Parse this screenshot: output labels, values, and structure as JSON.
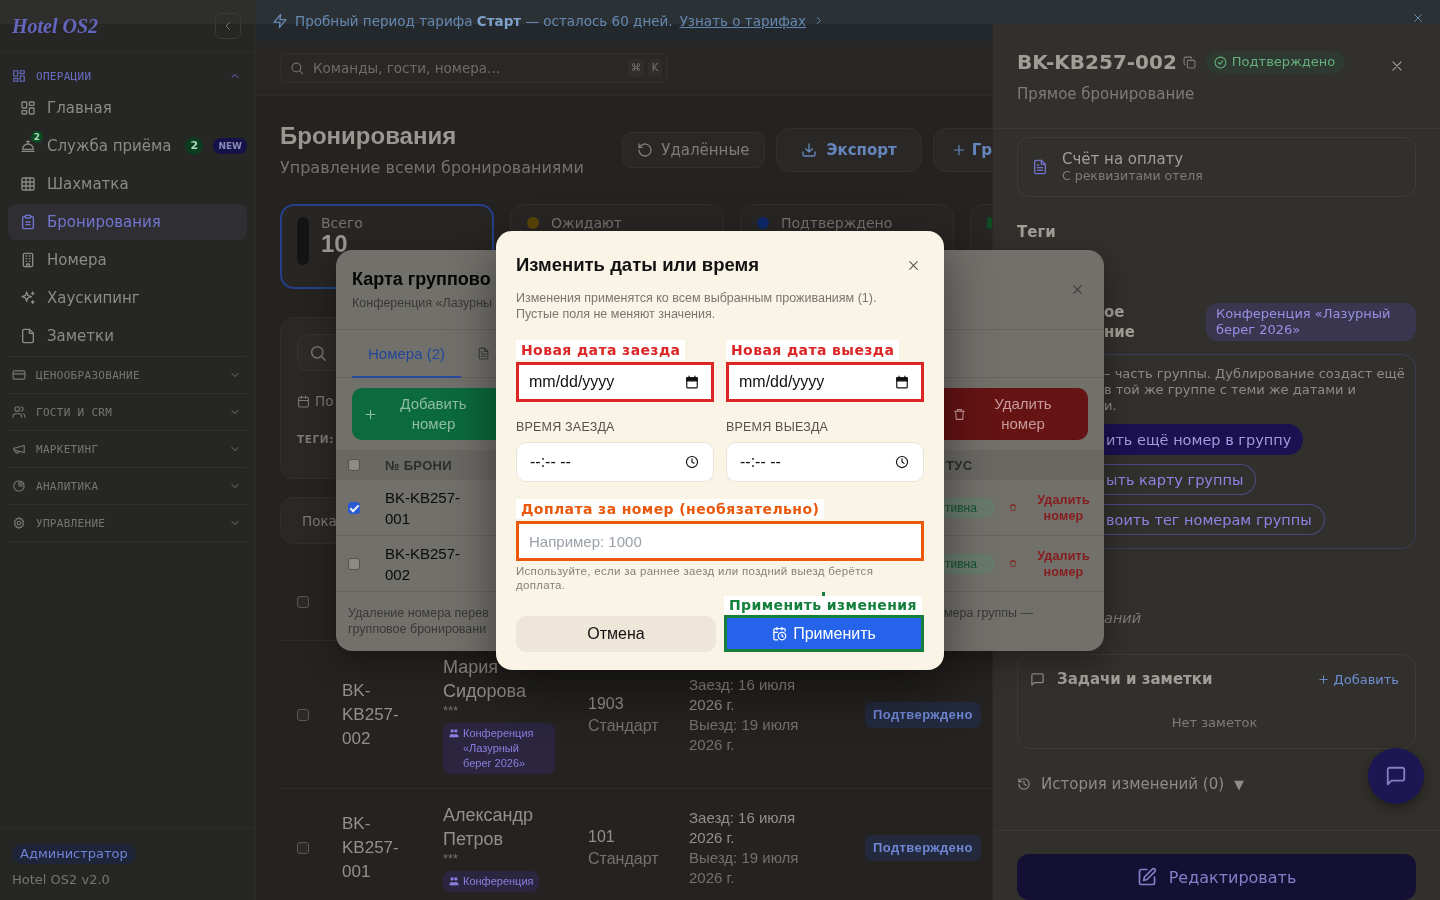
{
  "sidebar": {
    "logo": "Hotel OS2",
    "sections": [
      {
        "title": "ОПЕРАЦИИ",
        "expanded": true,
        "items": [
          {
            "label": "Главная",
            "selected": false
          },
          {
            "label": "Служба приёма",
            "selected": false,
            "icon_badge": "2",
            "count": "2",
            "badge": "NEW"
          },
          {
            "label": "Шахматка",
            "selected": false
          },
          {
            "label": "Бронирования",
            "selected": true
          },
          {
            "label": "Номера",
            "selected": false
          },
          {
            "label": "Хаускипинг",
            "selected": false
          },
          {
            "label": "Заметки",
            "selected": false
          }
        ]
      },
      {
        "title": "ЦЕНООБРАЗОВАНИЕ",
        "expanded": false
      },
      {
        "title": "ГОСТИ И CRM",
        "expanded": false
      },
      {
        "title": "МАРКЕТИНГ",
        "expanded": false
      },
      {
        "title": "АНАЛИТИКА",
        "expanded": false
      },
      {
        "title": "УПРАВЛЕНИЕ",
        "expanded": false
      }
    ],
    "role": "Администратор",
    "version": "Hotel OS2 v2.0"
  },
  "banner": {
    "text": "Пробный период тарифа **Старт** — осталось 60 дней.",
    "link": "Узнать о тарифах"
  },
  "search": {
    "placeholder": "Команды, гости, номера...",
    "keys": [
      "⌘",
      "K"
    ]
  },
  "page": {
    "title": "Бронирования",
    "subtitle": "Управление всеми бронированиями",
    "actions": [
      {
        "kind": "restore",
        "label": "Удалённые"
      },
      {
        "kind": "export",
        "label": "Экспорт"
      },
      {
        "kind": "create",
        "label": "Гр"
      }
    ]
  },
  "stats": [
    {
      "label": "Всего",
      "value": "10",
      "color": "#141414",
      "selected": true
    },
    {
      "label": "Ожидают",
      "color": "#5a4408",
      "selected": false
    },
    {
      "label": "Подтверждено",
      "color": "#0e2a6a",
      "selected": false
    },
    {
      "color": "#0f4a22",
      "selected": false
    }
  ],
  "filters": {
    "date_label": "По",
    "tags_label": "ТЕГИ:"
  },
  "view_label": "Пока",
  "bookings": {
    "all_selected": false,
    "rows": [
      {
        "selected": false,
        "id": "BK-KB257-002",
        "guest": "Мария Сидорова",
        "rating": "***",
        "tag": "Конференция «Лазурный берег 2026»",
        "room": "1903",
        "room_type": "Стандарт",
        "checkin": "Заезд: 16 июля 2026 г.",
        "checkout": "Выезд: 19 июля 2026 г.",
        "status": "Подтверждено"
      },
      {
        "selected": false,
        "id": "BK-KB257-001",
        "guest": "Александр Петров",
        "rating": "***",
        "tag": "Конференция",
        "room": "101",
        "room_type": "Стандарт",
        "checkin": "Заезд: 16 июля 2026 г.",
        "checkout": "Выезд: 19 июля 2026 г.",
        "status": "Подтверждено"
      }
    ]
  },
  "drawer": {
    "id": "BK-KB257-002",
    "status": "Подтверждено",
    "source": "Прямое бронирование",
    "invoice": {
      "title": "Счёт на оплату",
      "subtitle": "С реквизитами отеля"
    },
    "tags_title": "Теги",
    "group_label": [
      "ое",
      "ние"
    ],
    "group_tag": "Конференция «Лазурный берег 2026»",
    "group_text": [
      "– часть группы. Дублирование создаст ещё",
      "в той же группе с теми же датами и",
      "и."
    ],
    "group_actions": [
      {
        "kind": "primary",
        "label": "ить ещё номер в группу"
      },
      {
        "kind": "outline",
        "label": "ыть карту группы"
      },
      {
        "kind": "outline",
        "label": "воить тег номерам группы"
      }
    ],
    "empty_note": "аний",
    "notes": {
      "title": "Задачи и заметки",
      "add": "Добавить",
      "empty": "Нет заметок"
    },
    "history": {
      "label": "История изменений (0)",
      "toggle": "▼"
    },
    "edit": "Редактировать"
  },
  "group_card": {
    "title": "Карта группово",
    "subtitle": "Конференция «Лазурны",
    "tabs": [
      {
        "label": "Номера (2)",
        "selected": true
      },
      {
        "selected": false
      }
    ],
    "actions": [
      {
        "kind": "add",
        "label": "Добавить номер"
      },
      {
        "kind": "remove",
        "label": "Удалить номер"
      }
    ],
    "columns": [
      "№ БРОНИ",
      "ТУС"
    ],
    "all_selected": false,
    "rows": [
      {
        "selected": true,
        "id": "BK-KB257-001",
        "status": "тивна",
        "action": "Удалить номер"
      },
      {
        "selected": false,
        "id": "BK-KB257-002",
        "status": "тивна",
        "action": "Удалить номер"
      }
    ],
    "footer_left": [
      "Удаление номера перев",
      "групповое бронировани"
    ],
    "footer_right": "мера группы —"
  },
  "dialog": {
    "title": "Изменить даты или время",
    "description": "Изменения применятся ко всем выбранным проживаниям (1). Пустые поля не меняют значения.",
    "fields": [
      {
        "kind": "date",
        "label": "Новая дата заезда",
        "color": "#dc2626",
        "placeholder": "mm/dd/yyyy"
      },
      {
        "kind": "date",
        "label": "Новая дата выезда",
        "color": "#dc2626",
        "placeholder": "mm/dd/yyyy"
      },
      {
        "kind": "time",
        "label": "ВРЕМЯ ЗАЕЗДА",
        "placeholder": "--:-- --"
      },
      {
        "kind": "time",
        "label": "ВРЕМЯ ВЫЕЗДА",
        "placeholder": "--:-- --"
      },
      {
        "kind": "number",
        "label": "Доплата за номер (необязательно)",
        "color": "#ea580c",
        "placeholder": "Например: 1000",
        "hint": "Используйте, если за раннее заезд или поздний выезд берётся доплата."
      }
    ],
    "buttons": [
      {
        "kind": "secondary",
        "label": "Отмена"
      },
      {
        "kind": "primary",
        "label": "Применить",
        "callout": "Применить изменения",
        "color": "#15803d"
      }
    ]
  }
}
